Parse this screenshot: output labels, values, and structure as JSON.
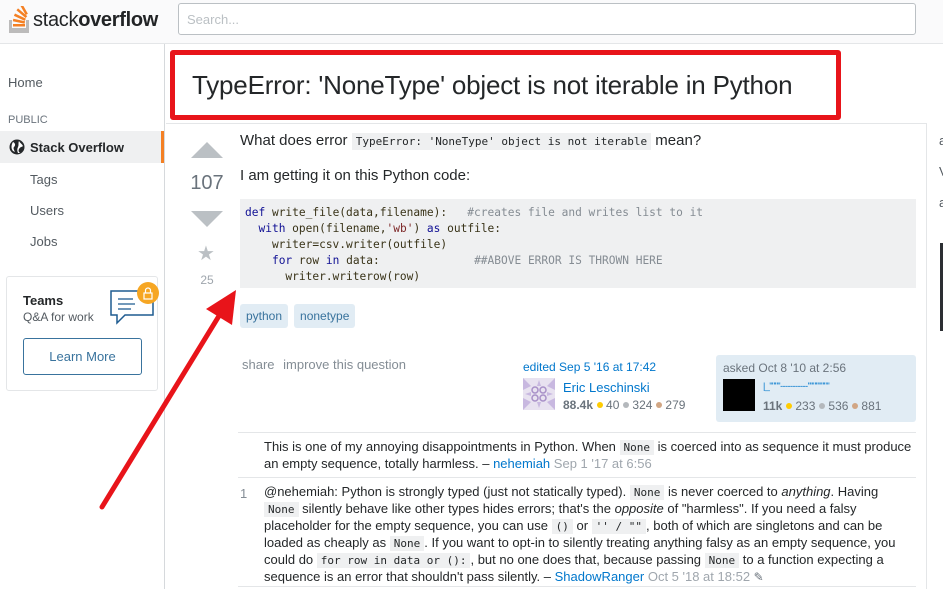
{
  "header": {
    "logo_text_light": "stack",
    "logo_text_bold": "overflow",
    "search_placeholder": "Search..."
  },
  "sidebar": {
    "home": "Home",
    "section_label": "PUBLIC",
    "active_item": "Stack Overflow",
    "items": [
      "Tags",
      "Users",
      "Jobs"
    ],
    "teams": {
      "title": "Teams",
      "subtitle": "Q&A for work",
      "button": "Learn More"
    }
  },
  "question": {
    "title": "TypeError: 'NoneType' object is not iterable in Python",
    "votes": "107",
    "favorites": "25",
    "body_p1_before": "What does error ",
    "body_p1_code": "TypeError: 'NoneType' object is not iterable",
    "body_p1_after": " mean?",
    "body_p2": "I am getting it on this Python code:",
    "code_lines": [
      "def write_file(data,filename):   #creates file and writes list to it",
      "  with open(filename,'wb') as outfile:",
      "    writer=csv.writer(outfile)",
      "    for row in data:              ##ABOVE ERROR IS THROWN HERE",
      "      writer.writerow(row)"
    ],
    "tags": [
      "python",
      "nonetype"
    ],
    "menu": [
      "share",
      "improve this question"
    ],
    "editor": {
      "action": "edited Sep 5 '16 at 17:42",
      "name": "Eric Leschinski",
      "reputation": "88.4k",
      "gold": "40",
      "silver": "324",
      "bronze": "279"
    },
    "owner": {
      "action": "asked Oct 8 '10 at 2:56",
      "name": "|_\"\"\"\"-----------\"\"\"\"\"\"\"\"",
      "reputation": "11k",
      "gold": "233",
      "silver": "536",
      "bronze": "881"
    }
  },
  "comments": [
    {
      "score": "",
      "t1": "This is one of my annoying disappointments in Python. When ",
      "c1": "None",
      "t2": " is coerced into as sequence it must produce an empty sequence, totally harmless. – ",
      "user": "nehemiah",
      "date": "Sep 1 '17 at 6:56"
    },
    {
      "score": "1",
      "t1": "@nehemiah: Python is strongly typed (just not statically typed). ",
      "c1": "None",
      "t2": " is never coerced to ",
      "em1": "anything",
      "t3": ". Having ",
      "c2": "None",
      "t4": " silently behave like other types hides errors; that's the ",
      "em2": "opposite",
      "t5": " of \"harmless\". If you need a falsy placeholder for the empty sequence, you can use ",
      "c3": "()",
      "t6": " or ",
      "c4": "'' / \"\"",
      "t7": ", both of which are singletons and can be loaded as cheaply as ",
      "c5": "None",
      "t8": ". If you want to opt-in to silently treating anything falsy as an empty sequence, you could do ",
      "c6": "for row in data or ():",
      "t9": ", but no one does that, because passing ",
      "c7": "None",
      "t10": " to a function expecting a sequence is an error that shouldn't pass silently. – ",
      "user": "ShadowRanger",
      "date": "Oct 5 '18 at 18:52"
    }
  ],
  "right_column": {
    "fragments": [
      "a",
      "V",
      "a"
    ]
  },
  "colors": {
    "annotation_red": "#e8141a",
    "brand_orange": "#f48024",
    "link_blue": "#0077cc",
    "tag_bg": "#e1ecf4"
  }
}
